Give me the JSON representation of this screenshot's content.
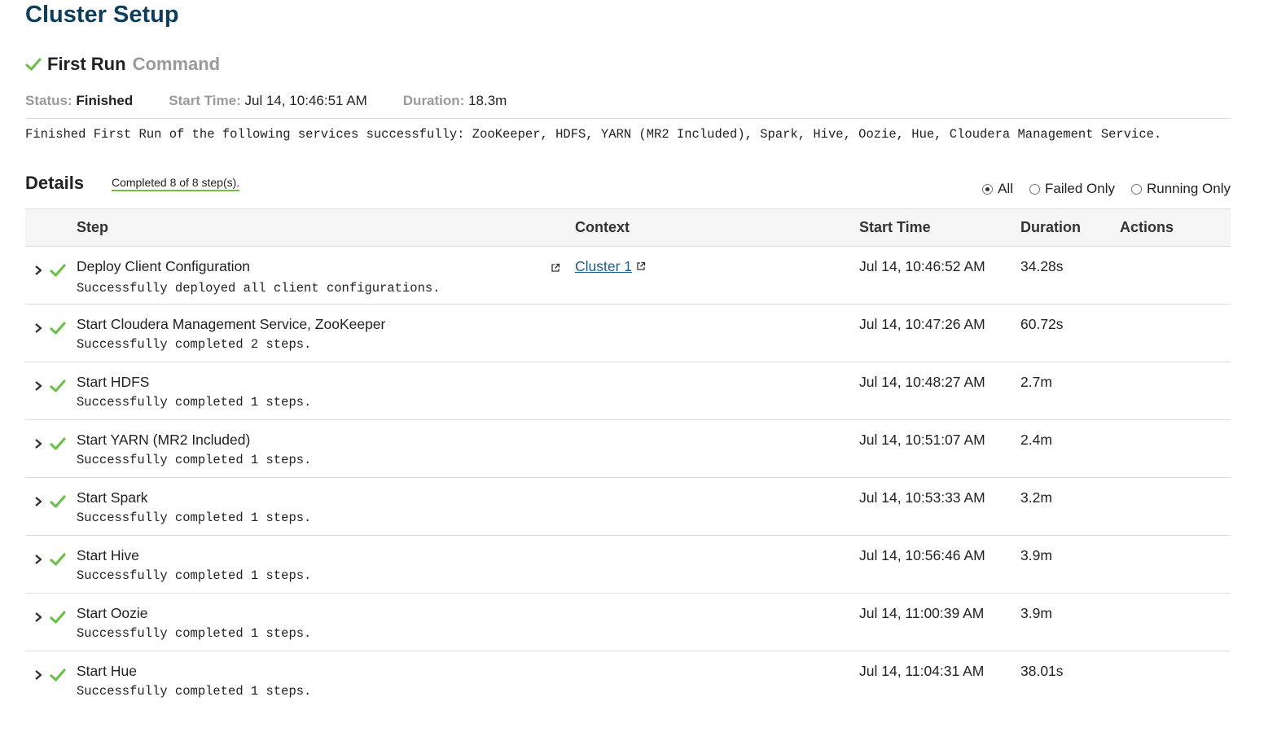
{
  "page": {
    "title": "Cluster Setup"
  },
  "command": {
    "name": "First Run",
    "kind": "Command",
    "status_label": "Status:",
    "status_value": "Finished",
    "start_label": "Start Time:",
    "start_value": "Jul 14, 10:46:51 AM",
    "duration_label": "Duration:",
    "duration_value": "18.3m",
    "result_message": "Finished First Run of the following services successfully: ZooKeeper, HDFS, YARN (MR2 Included), Spark, Hive, Oozie, Hue, Cloudera Management Service."
  },
  "details": {
    "title": "Details",
    "progress": "Completed 8 of 8 step(s).",
    "filters": [
      {
        "label": "All",
        "selected": true
      },
      {
        "label": "Failed Only",
        "selected": false
      },
      {
        "label": "Running Only",
        "selected": false
      }
    ],
    "columns": {
      "step": "Step",
      "context": "Context",
      "start_time": "Start Time",
      "duration": "Duration",
      "actions": "Actions"
    },
    "steps": [
      {
        "title": "Deploy Client Configuration",
        "message": "Successfully deployed all client configurations.",
        "context": "Cluster 1",
        "start": "Jul 14, 10:46:52 AM",
        "duration": "34.28s",
        "has_link": true
      },
      {
        "title": "Start Cloudera Management Service, ZooKeeper",
        "message": "Successfully completed 2 steps.",
        "context": "",
        "start": "Jul 14, 10:47:26 AM",
        "duration": "60.72s",
        "has_link": false
      },
      {
        "title": "Start HDFS",
        "message": "Successfully completed 1 steps.",
        "context": "",
        "start": "Jul 14, 10:48:27 AM",
        "duration": "2.7m",
        "has_link": false
      },
      {
        "title": "Start YARN (MR2 Included)",
        "message": "Successfully completed 1 steps.",
        "context": "",
        "start": "Jul 14, 10:51:07 AM",
        "duration": "2.4m",
        "has_link": false
      },
      {
        "title": "Start Spark",
        "message": "Successfully completed 1 steps.",
        "context": "",
        "start": "Jul 14, 10:53:33 AM",
        "duration": "3.2m",
        "has_link": false
      },
      {
        "title": "Start Hive",
        "message": "Successfully completed 1 steps.",
        "context": "",
        "start": "Jul 14, 10:56:46 AM",
        "duration": "3.9m",
        "has_link": false
      },
      {
        "title": "Start Oozie",
        "message": "Successfully completed 1 steps.",
        "context": "",
        "start": "Jul 14, 11:00:39 AM",
        "duration": "3.9m",
        "has_link": false
      },
      {
        "title": "Start Hue",
        "message": "Successfully completed 1 steps.",
        "context": "",
        "start": "Jul 14, 11:04:31 AM",
        "duration": "38.01s",
        "has_link": false
      }
    ]
  },
  "icons": {
    "success": "check-icon",
    "expand": "chevron-right-icon",
    "external": "external-link-icon"
  },
  "colors": {
    "title": "#0f3e5b",
    "success": "#6cc04a",
    "link": "#1a5e8c",
    "muted": "#9a9a9a"
  }
}
